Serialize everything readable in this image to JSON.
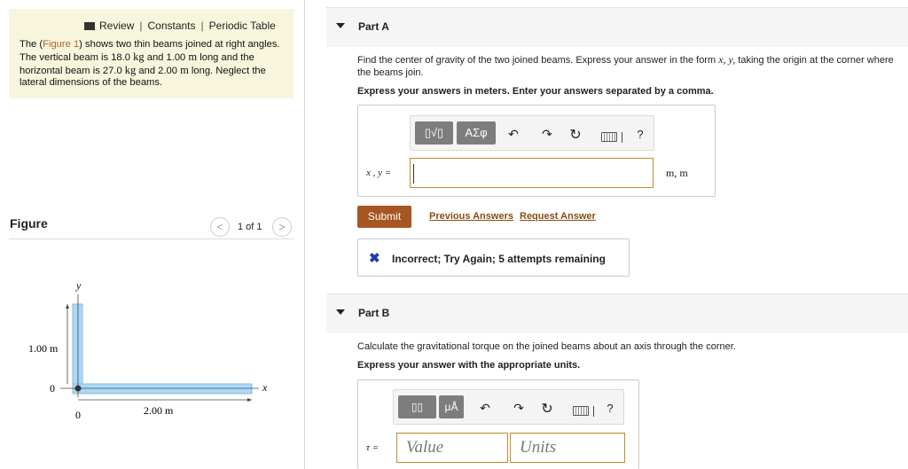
{
  "header_links": {
    "review": "Review",
    "separator": "|",
    "constants": "Constants",
    "periodic_table": "Periodic Table"
  },
  "problem": {
    "p1": "The (",
    "figure_link": "Figure 1",
    "p2": ") shows two thin beams joined at right angles. The vertical beam is 18.0",
    "kg1": "kg",
    "p3": "and 1.00",
    "m1": "m",
    "p4": "long and the horizontal beam is 27.0",
    "kg2": "kg",
    "p5": "and 2.00",
    "m2": "m",
    "p6": "long. Neglect the lateral dimensions of the beams."
  },
  "figure": {
    "title": "Figure",
    "pager_text": "1 of 1",
    "prev": "<",
    "next": ">",
    "y_axis": "y",
    "x_axis": "x",
    "vertical_length": "1.00 m",
    "horizontal_length": "2.00 m",
    "origin_y": "0",
    "origin_x": "0",
    "beam_color": "#add8f7"
  },
  "partA": {
    "title": "Part A",
    "question_1": "Find the center of gravity of the two joined beams. Express your answer in the form",
    "question_math": "x, y,",
    "question_2": "taking the origin at the corner where the beams join.",
    "instruction": "Express your answers in meters. Enter your answers separated by a comma.",
    "toolbar": {
      "templates": "▯√▯",
      "greek": "ΑΣφ",
      "undo": "↶",
      "redo": "↷",
      "reset": "↻",
      "help": "?"
    },
    "input_label": "x , y =",
    "input_value": "",
    "unit_label": "m, m",
    "submit": "Submit",
    "previous_answers": "Previous Answers",
    "request_answer": "Request Answer",
    "feedback_icon": "✖",
    "feedback": "Incorrect; Try Again; 5 attempts remaining"
  },
  "partB": {
    "title": "Part B",
    "question": "Calculate the gravitational torque on the joined beams about an axis through the corner.",
    "instruction": "Express your answer with the appropriate units.",
    "toolbar": {
      "templates": "▯▯",
      "units": "μÅ",
      "undo": "↶",
      "redo": "↷",
      "reset": "↻",
      "help": "?"
    },
    "input_label": "τ =",
    "value_placeholder": "Value",
    "units_placeholder": "Units"
  },
  "colors": {
    "submit": "#a75522",
    "link": "#8a4b14",
    "feedback_x": "#1a3fa8",
    "input_border": "#c08a2d"
  }
}
